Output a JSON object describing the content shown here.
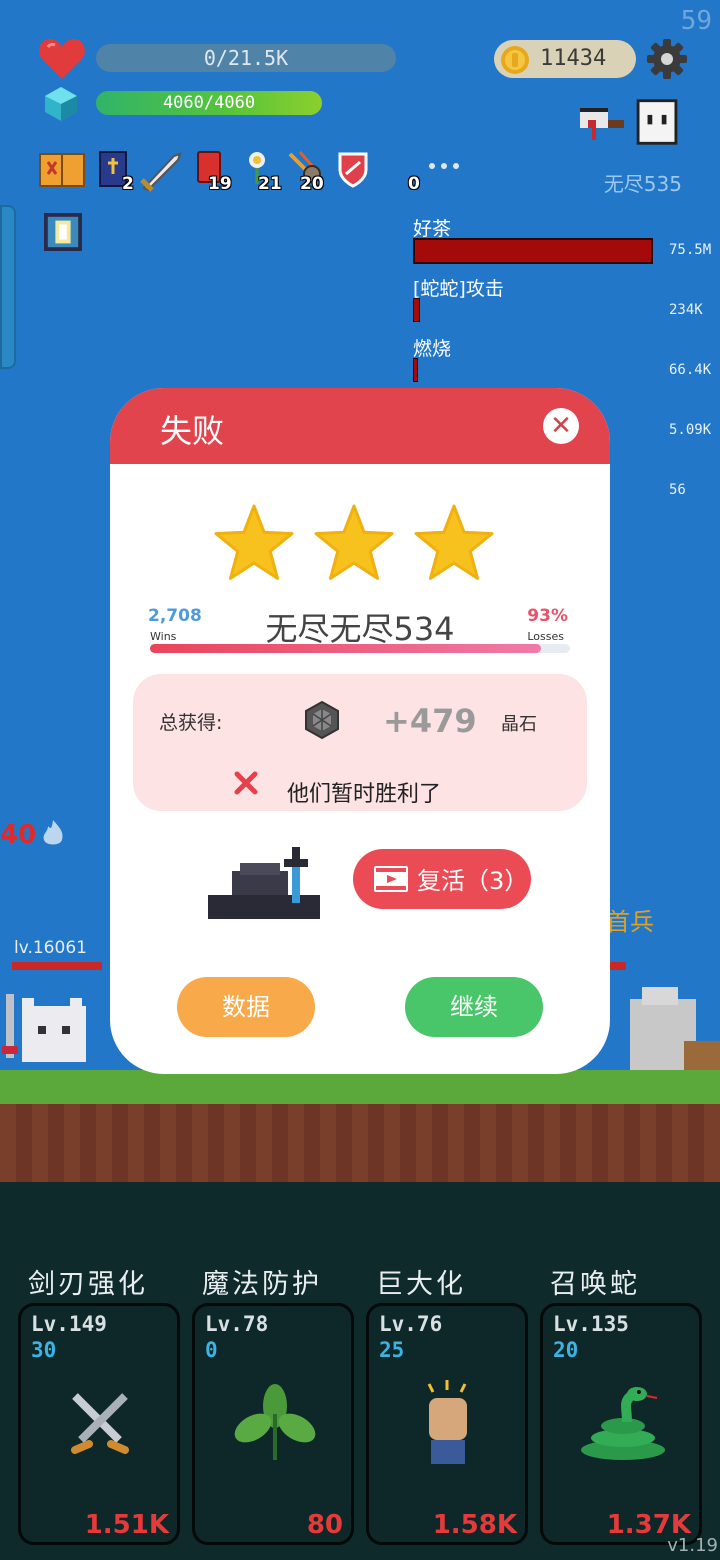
{
  "fps": "59",
  "hud": {
    "hp_text": "0/21.5K",
    "mp_text": "4060/4060",
    "coins": "11434",
    "endless_label": "无尽535",
    "items": [
      {
        "icon": "book-icon",
        "count": ""
      },
      {
        "icon": "bible-icon",
        "count": "2"
      },
      {
        "icon": "sword-icon",
        "count": ""
      },
      {
        "icon": "red-card-icon",
        "count": "19"
      },
      {
        "icon": "flower-icon",
        "count": "21"
      },
      {
        "icon": "meteor-icon",
        "count": "20"
      },
      {
        "icon": "shield-icon",
        "count": ""
      },
      {
        "icon": "more-icon",
        "count": "0"
      }
    ]
  },
  "damage_stats": [
    {
      "name": "好茶",
      "value": "75.5M",
      "fraction": 1.0
    },
    {
      "name": "[蛇蛇]攻击",
      "value": "234K",
      "fraction": 0.02
    },
    {
      "name": "燃烧",
      "value": "66.4K",
      "fraction": 0.01
    },
    {
      "name": "",
      "value": "5.09K",
      "fraction": 0
    },
    {
      "name": "",
      "value": "56",
      "fraction": 0
    }
  ],
  "scene": {
    "left_counter": "40",
    "left_level": "lv.16061",
    "right_name": "首兵"
  },
  "modal": {
    "title": "失败",
    "stars": 3,
    "wins_value": "2,708",
    "wins_label": "Wins",
    "stage_name": "无尽无尽534",
    "losses_value": "93%",
    "losses_label": "Losses",
    "progress": 0.93,
    "reward_label": "总获得:",
    "reward_amount": "+479",
    "reward_unit": "晶石",
    "reward_message": "他们暂时胜利了",
    "revive_label": "复活（3）",
    "data_button": "数据",
    "continue_button": "继续"
  },
  "skills": [
    {
      "title": "剑刃强化",
      "level": "Lv.149",
      "count": "30",
      "cost": "1.51K",
      "icon": "crossed-swords-icon"
    },
    {
      "title": "魔法防护",
      "level": "Lv.78",
      "count": "0",
      "cost": "80",
      "icon": "leaf-icon"
    },
    {
      "title": "巨大化",
      "level": "Lv.76",
      "count": "25",
      "cost": "1.58K",
      "icon": "fist-icon"
    },
    {
      "title": "召唤蛇",
      "level": "Lv.135",
      "count": "20",
      "cost": "1.37K",
      "icon": "snake-icon"
    }
  ],
  "version": "v1.19",
  "colors": {
    "background": "#2277c8",
    "modal_header": "#e1444c",
    "revive": "#ea4b55",
    "data_button": "#f8a94a",
    "continue_button": "#4ac66a",
    "cost": "#e63a3a"
  }
}
